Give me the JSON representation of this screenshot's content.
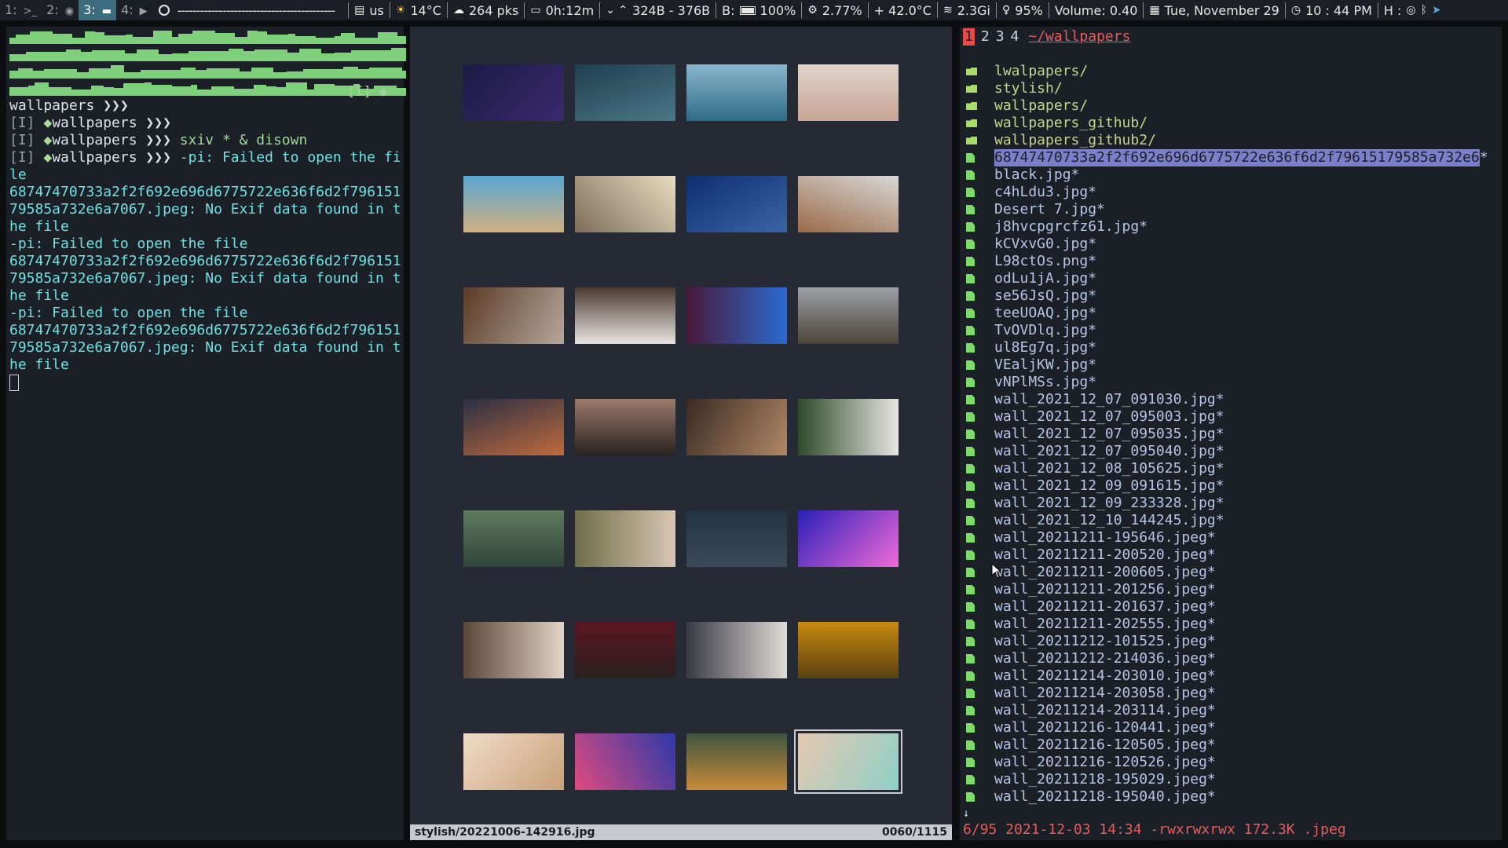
{
  "topbar": {
    "workspaces": [
      {
        "label": "1: ",
        "icon": ">_",
        "active": false
      },
      {
        "label": "2: ",
        "icon": "◉",
        "active": false
      },
      {
        "label": "3: ",
        "icon": "▬",
        "active": true
      },
      {
        "label": "4: ",
        "icon": "▶",
        "active": false
      }
    ],
    "window_title": "------------------------------------------",
    "keyboard_layout": "us",
    "weather": "14°C",
    "packages": "264 pks",
    "uptime": "0h:12m",
    "network": "324B - 376B",
    "battery_label": "B:",
    "battery": "100%",
    "cpu": "2.77%",
    "temperature": "+ 42.0°C",
    "memory": "2.3Gi",
    "brightness": "95%",
    "volume": "Volume: 0.40",
    "date": "Tue, November 29",
    "time": "10 : 44 PM",
    "host": "H :"
  },
  "terminal": {
    "prompt_tail": "[I] ◆",
    "lines": [
      {
        "segments": [
          {
            "text": "wallpapers ❯❯❯",
            "cls": "t-white"
          }
        ]
      },
      {
        "segments": [
          {
            "text": "[I] ",
            "cls": "t-dim"
          },
          {
            "text": "◆",
            "cls": "t-dia"
          },
          {
            "text": "wallpapers ❯❯❯",
            "cls": "t-white"
          }
        ]
      },
      {
        "segments": [
          {
            "text": "[I] ",
            "cls": "t-dim"
          },
          {
            "text": "◆",
            "cls": "t-dia"
          },
          {
            "text": "wallpapers ❯❯❯ ",
            "cls": "t-white"
          },
          {
            "text": "sxiv * & disown",
            "cls": "t-green"
          }
        ]
      },
      {
        "segments": [
          {
            "text": "[I] ",
            "cls": "t-dim"
          },
          {
            "text": "◆",
            "cls": "t-dia"
          },
          {
            "text": "wallpapers ❯❯❯ ",
            "cls": "t-white"
          },
          {
            "text": "-pi: Failed to open the file",
            "cls": ""
          }
        ]
      },
      {
        "segments": [
          {
            "text": "68747470733a2f2f692e696d6775722e636f6d2f79615179585a732e6a7067.jpeg: No Exif data found in the file",
            "cls": ""
          }
        ]
      },
      {
        "segments": [
          {
            "text": "-pi: Failed to open the file",
            "cls": ""
          }
        ]
      },
      {
        "segments": [
          {
            "text": "68747470733a2f2f692e696d6775722e636f6d2f79615179585a732e6a7067.jpeg: No Exif data found in the file",
            "cls": ""
          }
        ]
      },
      {
        "segments": [
          {
            "text": "-pi: Failed to open the file",
            "cls": ""
          }
        ]
      },
      {
        "segments": [
          {
            "text": "68747470733a2f2f692e696d6775722e636f6d2f79615179585a732e6a7067.jpeg: No Exif data found in the file",
            "cls": ""
          }
        ]
      }
    ]
  },
  "viewer": {
    "current_file": "stylish/20221006-142916.jpg",
    "counter": "0060/1115",
    "thumbnails": [
      {
        "name": "thumb-keyboard",
        "c1": "#1c1a45",
        "c2": "#3a2a6e",
        "dir": "135deg"
      },
      {
        "name": "thumb-ocean-waves",
        "c1": "#1f3f4f",
        "c2": "#4b7787",
        "dir": "160deg"
      },
      {
        "name": "thumb-calm-sea",
        "c1": "#8ab6cc",
        "c2": "#2e6c86",
        "dir": "180deg"
      },
      {
        "name": "thumb-beach-haze",
        "c1": "#e0d4cc",
        "c2": "#c8a594",
        "dir": "180deg"
      },
      {
        "name": "thumb-sandy-beach",
        "c1": "#5aa7d0",
        "c2": "#d0b080",
        "dir": "180deg"
      },
      {
        "name": "thumb-building",
        "c1": "#7d6d58",
        "c2": "#e8dcc2",
        "dir": "45deg"
      },
      {
        "name": "thumb-jellyfish",
        "c1": "#0d2f6e",
        "c2": "#3b64a8",
        "dir": "150deg"
      },
      {
        "name": "thumb-laptop-dog",
        "c1": "#d8d8d6",
        "c2": "#9a6a48",
        "dir": "200deg"
      },
      {
        "name": "thumb-laptop-typing",
        "c1": "#5a3b26",
        "c2": "#b7a79a",
        "dir": "120deg"
      },
      {
        "name": "thumb-desk-setup",
        "c1": "#4a3a30",
        "c2": "#e8e4e0",
        "dir": "180deg"
      },
      {
        "name": "thumb-neon-synth",
        "c1": "#4a1838",
        "c2": "#2a6bd0",
        "dir": "90deg"
      },
      {
        "name": "thumb-mountain",
        "c1": "#9ca0a5",
        "c2": "#4b4438",
        "dir": "180deg"
      },
      {
        "name": "thumb-city-night",
        "c1": "#2b2f45",
        "c2": "#c06a3a",
        "dir": "160deg"
      },
      {
        "name": "thumb-dusk-silhouette",
        "c1": "#9a7a6a",
        "c2": "#2a2220",
        "dir": "180deg"
      },
      {
        "name": "thumb-blur-leaves",
        "c1": "#3a2a22",
        "c2": "#b08866",
        "dir": "120deg"
      },
      {
        "name": "thumb-plant-table",
        "c1": "#e8e6e2",
        "c2": "#2f4a2a",
        "dir": "270deg"
      },
      {
        "name": "thumb-green-sweater",
        "c1": "#5c7a5e",
        "c2": "#31463a",
        "dir": "180deg"
      },
      {
        "name": "thumb-mother-child",
        "c1": "#6f6d48",
        "c2": "#d8c6b4",
        "dir": "90deg"
      },
      {
        "name": "thumb-blazer",
        "c1": "#223344",
        "c2": "#3a4a5a",
        "dir": "180deg"
      },
      {
        "name": "thumb-color-swirl",
        "c1": "#2a1fb8",
        "c2": "#f06ad8",
        "dir": "135deg"
      },
      {
        "name": "thumb-city-aerial",
        "c1": "#5a4638",
        "c2": "#e2d4c6",
        "dir": "90deg"
      },
      {
        "name": "thumb-red-alley",
        "c1": "#5a1620",
        "c2": "#2a2020",
        "dir": "180deg"
      },
      {
        "name": "thumb-couple",
        "c1": "#3a3a44",
        "c2": "#e0dcd8",
        "dir": "90deg"
      },
      {
        "name": "thumb-sunflowers",
        "c1": "#c88a10",
        "c2": "#5a4010",
        "dir": "180deg"
      },
      {
        "name": "thumb-molecules",
        "c1": "#f0dcc8",
        "c2": "#c8a078",
        "dir": "135deg"
      },
      {
        "name": "thumb-abstract-waves",
        "c1": "#e04a80",
        "c2": "#2c3aa8",
        "dir": "60deg"
      },
      {
        "name": "thumb-old-car",
        "c1": "#3e5440",
        "c2": "#c88a3a",
        "dir": "180deg"
      },
      {
        "name": "thumb-pool-aerial",
        "c1": "#e6c8b0",
        "c2": "#8ed0c8",
        "dir": "120deg",
        "selected": true
      }
    ]
  },
  "filemanager": {
    "tabs": [
      "1",
      "2",
      "3",
      "4"
    ],
    "path": "~/wallpapers",
    "entries": [
      {
        "name": "lwalpapers/",
        "type": "dir"
      },
      {
        "name": "stylish/",
        "type": "dir"
      },
      {
        "name": "wallpapers/",
        "type": "dir"
      },
      {
        "name": "wallpapers_github/",
        "type": "dir"
      },
      {
        "name": "wallpapers_github2/",
        "type": "dir"
      },
      {
        "name": "68747470733a2f2f692e696d6775722e636f6d2f79615179585a732e6",
        "suffix": "*",
        "type": "file",
        "highlighted": true
      },
      {
        "name": "black.jpg*",
        "type": "file"
      },
      {
        "name": "c4hLdu3.jpg*",
        "type": "file"
      },
      {
        "name": "Desert 7.jpg*",
        "type": "file"
      },
      {
        "name": "j8hvcpgrcfz61.jpg*",
        "type": "file"
      },
      {
        "name": "kCVxvG0.jpg*",
        "type": "file"
      },
      {
        "name": "L98ctOs.png*",
        "type": "file"
      },
      {
        "name": "odLu1jA.jpg*",
        "type": "file"
      },
      {
        "name": "se56JsQ.jpg*",
        "type": "file"
      },
      {
        "name": "teeUOAQ.jpg*",
        "type": "file"
      },
      {
        "name": "TvOVDlq.jpg*",
        "type": "file"
      },
      {
        "name": "ul8Eg7q.jpg*",
        "type": "file"
      },
      {
        "name": "VEaljKW.jpg*",
        "type": "file"
      },
      {
        "name": "vNPlMSs.jpg*",
        "type": "file"
      },
      {
        "name": "wall_2021_12_07_091030.jpg*",
        "type": "file"
      },
      {
        "name": "wall_2021_12_07_095003.jpg*",
        "type": "file"
      },
      {
        "name": "wall_2021_12_07_095035.jpg*",
        "type": "file"
      },
      {
        "name": "wall_2021_12_07_095040.jpg*",
        "type": "file"
      },
      {
        "name": "wall_2021_12_08_105625.jpg*",
        "type": "file"
      },
      {
        "name": "wall_2021_12_09_091615.jpg*",
        "type": "file"
      },
      {
        "name": "wall_2021_12_09_233328.jpg*",
        "type": "file"
      },
      {
        "name": "wall_2021_12_10_144245.jpg*",
        "type": "file"
      },
      {
        "name": "wall_20211211-195646.jpeg*",
        "type": "file"
      },
      {
        "name": "wall_20211211-200520.jpeg*",
        "type": "file"
      },
      {
        "name": "wall_20211211-200605.jpeg*",
        "type": "file"
      },
      {
        "name": "wall_20211211-201256.jpeg*",
        "type": "file"
      },
      {
        "name": "wall_20211211-201637.jpeg*",
        "type": "file"
      },
      {
        "name": "wall_20211211-202555.jpeg*",
        "type": "file"
      },
      {
        "name": "wall_20211212-101525.jpeg*",
        "type": "file"
      },
      {
        "name": "wall_20211212-214036.jpeg*",
        "type": "file"
      },
      {
        "name": "wall_20211214-203010.jpeg*",
        "type": "file"
      },
      {
        "name": "wall_20211214-203058.jpeg*",
        "type": "file"
      },
      {
        "name": "wall_20211214-203114.jpeg*",
        "type": "file"
      },
      {
        "name": "wall_20211216-120441.jpeg*",
        "type": "file"
      },
      {
        "name": "wall_20211216-120505.jpeg*",
        "type": "file"
      },
      {
        "name": "wall_20211216-120526.jpeg*",
        "type": "file"
      },
      {
        "name": "wall_20211218-195029.jpeg*",
        "type": "file"
      },
      {
        "name": "wall_20211218-195040.jpeg*",
        "type": "file"
      }
    ],
    "more_indicator": "↓",
    "status": "6/95 2021-12-03 14:34 -rwxrwxrwx 172.3K .jpeg"
  },
  "colors": {
    "accent_red": "#e85c5c",
    "highlight": "#7b7fc9",
    "terminal_text": "#6fe0e4",
    "visualizer_green": "#7fd07a"
  }
}
